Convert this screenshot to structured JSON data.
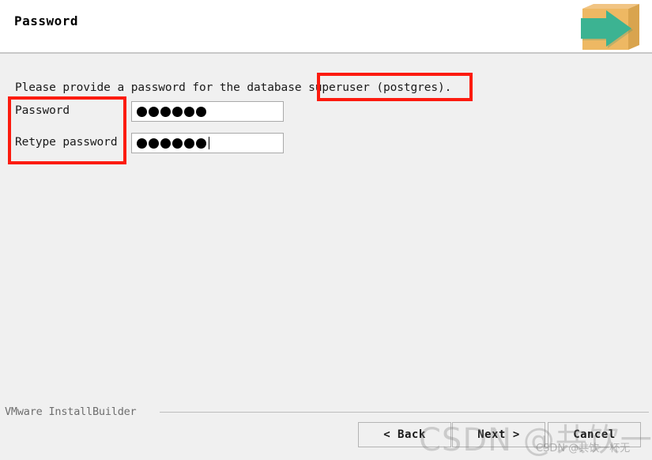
{
  "header": {
    "title": "Password",
    "icon": "installer-box-arrow-icon"
  },
  "main": {
    "instruction": "Please provide a password for the database superuser (postgres).",
    "fields": [
      {
        "label": "Password",
        "value": "●●●●●●",
        "dots": 6,
        "focused": false
      },
      {
        "label": "Retype password",
        "value": "●●●●●●",
        "dots": 6,
        "focused": true
      }
    ]
  },
  "annotations": [
    {
      "name": "password-labels-highlight",
      "color": "#fc1b0f"
    },
    {
      "name": "superuser-text-highlight",
      "color": "#fc1b0f"
    }
  ],
  "footer": {
    "brand": "VMware InstallBuilder",
    "buttons": {
      "back": "< Back",
      "next": "Next >",
      "cancel": "Cancel"
    }
  },
  "watermark": {
    "large": "CSDN @共饮一杯无",
    "small": "CSDN @共饮一杯无"
  },
  "colors": {
    "window_bg": "#f0f0f0",
    "header_bg": "#ffffff",
    "annotation_red": "#fc1b0f",
    "icon_box": "#eeb863",
    "icon_arrow": "#3cb392"
  }
}
